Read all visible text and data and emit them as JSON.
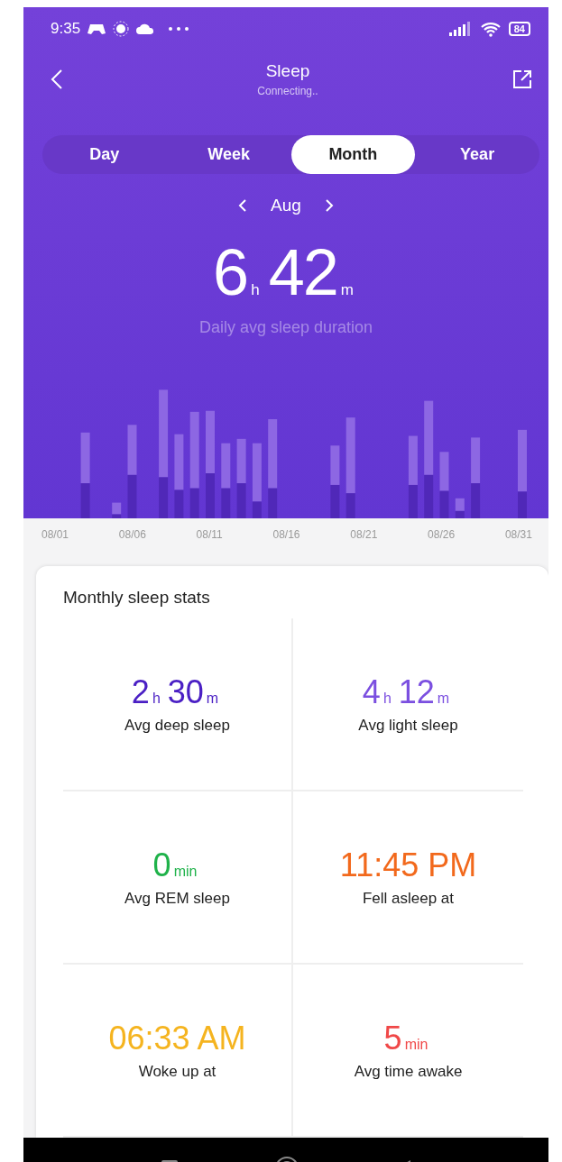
{
  "status_bar": {
    "time": "9:35",
    "battery": "84"
  },
  "header": {
    "title": "Sleep",
    "subtitle": "Connecting.."
  },
  "tabs": [
    {
      "label": "Day",
      "selected": false
    },
    {
      "label": "Week",
      "selected": false
    },
    {
      "label": "Month",
      "selected": true
    },
    {
      "label": "Year",
      "selected": false
    }
  ],
  "period": {
    "label": "Aug"
  },
  "summary": {
    "value": [
      {
        "text": "6",
        "kind": "number"
      },
      {
        "text": "h",
        "kind": "unit"
      },
      {
        "text": "42",
        "kind": "number"
      },
      {
        "text": "m",
        "kind": "unit"
      }
    ],
    "caption": "Daily avg sleep duration"
  },
  "chart": {
    "date_labels": [
      "08/01",
      "08/06",
      "08/11",
      "08/16",
      "08/21",
      "08/26",
      "08/31"
    ]
  },
  "stats": {
    "title": "Monthly sleep stats",
    "items": [
      {
        "value": [
          {
            "text": "2",
            "kind": "number"
          },
          {
            "text": "h",
            "kind": "unit"
          },
          {
            "text": "30",
            "kind": "number"
          },
          {
            "text": "m",
            "kind": "unit"
          }
        ],
        "label": "Avg deep sleep",
        "color": "#4a1fc4"
      },
      {
        "value": [
          {
            "text": "4",
            "kind": "number"
          },
          {
            "text": "h",
            "kind": "unit"
          },
          {
            "text": "12",
            "kind": "number"
          },
          {
            "text": "m",
            "kind": "unit"
          }
        ],
        "label": "Avg light sleep",
        "color": "#7b4fe0"
      },
      {
        "value": [
          {
            "text": "0",
            "kind": "number"
          },
          {
            "text": "min",
            "kind": "unit"
          }
        ],
        "label": "Avg REM sleep",
        "color": "#1fb24a"
      },
      {
        "value": [
          {
            "text": "11:45 PM",
            "kind": "number"
          }
        ],
        "label": "Fell asleep at",
        "color": "#f2691c"
      },
      {
        "value": [
          {
            "text": "06:33 AM",
            "kind": "number"
          }
        ],
        "label": "Woke up at",
        "color": "#f5b41f"
      },
      {
        "value": [
          {
            "text": "5",
            "kind": "number"
          },
          {
            "text": "min",
            "kind": "unit"
          }
        ],
        "label": "Avg time awake",
        "color": "#f04848"
      }
    ]
  }
}
